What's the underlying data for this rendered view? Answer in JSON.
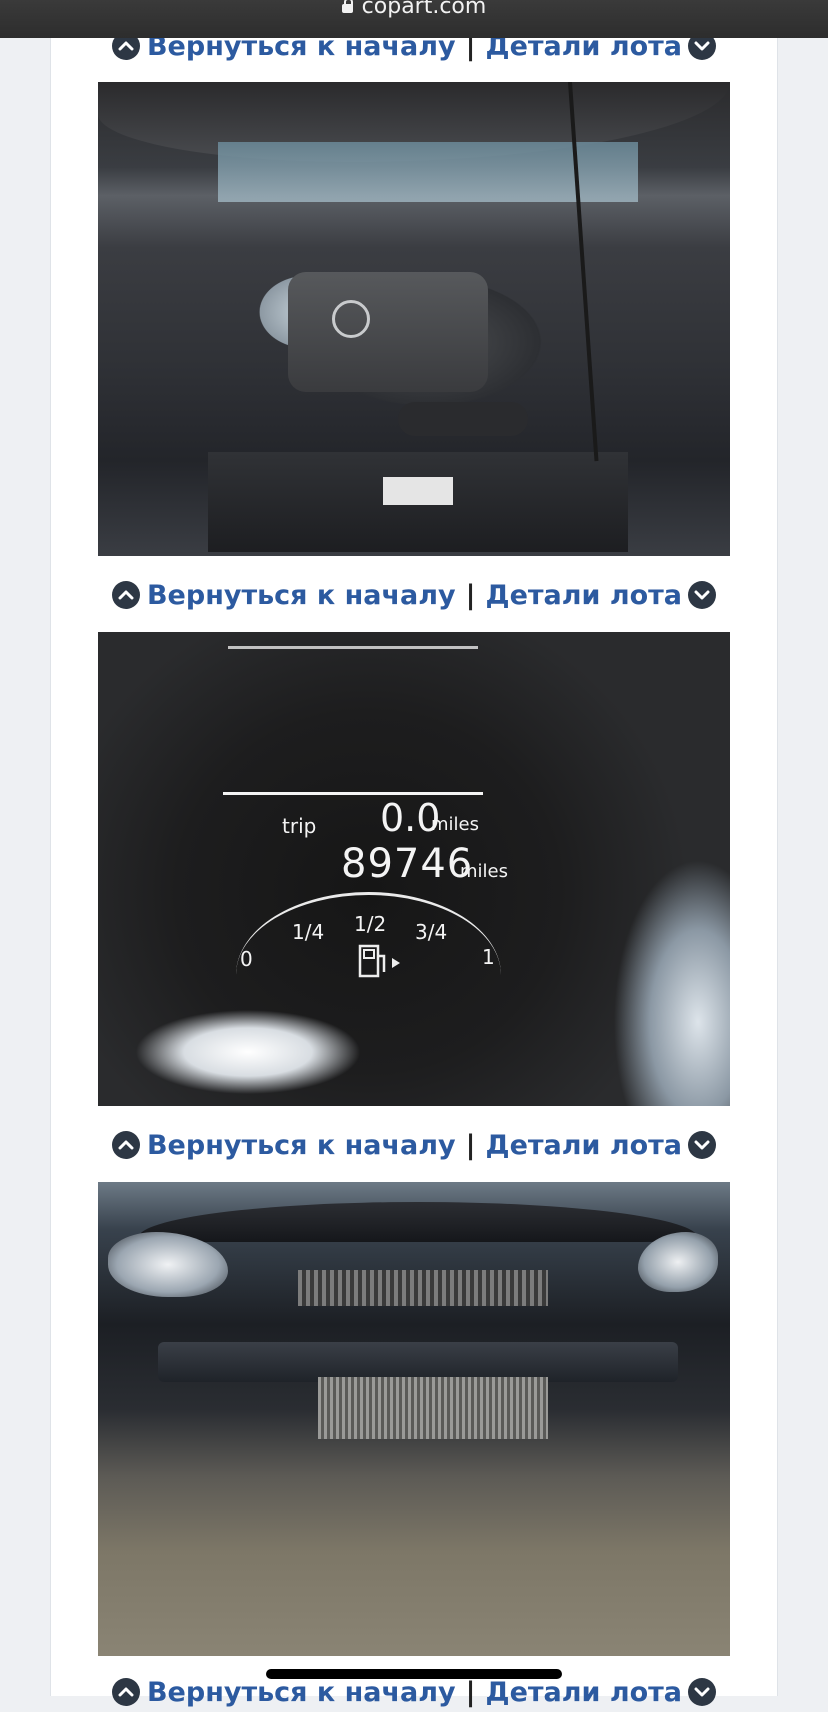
{
  "browser": {
    "domain": "copart.com"
  },
  "nav": {
    "back_to_top": "Вернуться к началу",
    "separator": "|",
    "lot_details": "Детали лота"
  },
  "photos": {
    "dashboard": {
      "trip_label": "trip",
      "trip_value": "0.0",
      "trip_unit": "miles",
      "odometer_value": "89746",
      "odometer_unit": "miles",
      "fuel_ticks": [
        "0",
        "1/4",
        "1/2",
        "3/4",
        "1"
      ]
    }
  },
  "colors": {
    "link": "#2c5aa0",
    "icon_circle": "#2d3744",
    "url_bar": "#333333"
  }
}
